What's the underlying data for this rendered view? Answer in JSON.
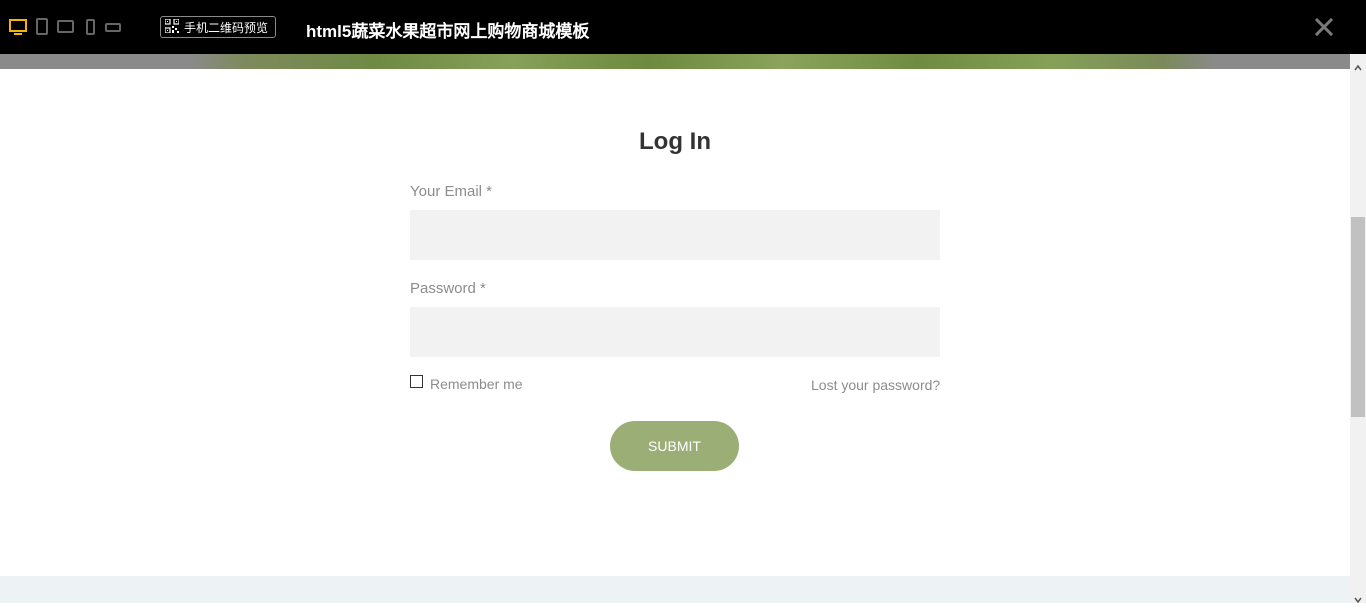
{
  "topbar": {
    "qr_label": "手机二维码预览",
    "site_title": "html5蔬菜水果超市网上购物商城模板",
    "colors": {
      "active_device": "#f5b400",
      "inactive_device": "#666666"
    },
    "icons": [
      "desktop-icon",
      "tablet-portrait-icon",
      "tablet-landscape-icon",
      "phone-portrait-icon",
      "phone-landscape-icon",
      "qr-code-icon",
      "close-icon"
    ]
  },
  "login": {
    "title": "Log In",
    "email_label": "Your Email *",
    "email_value": "",
    "password_label": "Password *",
    "password_value": "",
    "remember_label": "Remember me",
    "remember_checked": false,
    "lost_password": "Lost your password?",
    "submit_label": "SUBMIT",
    "colors": {
      "submit_bg": "#9aae76",
      "input_bg": "#f2f2f2",
      "label": "#8c8c8c",
      "title": "#333333"
    }
  }
}
